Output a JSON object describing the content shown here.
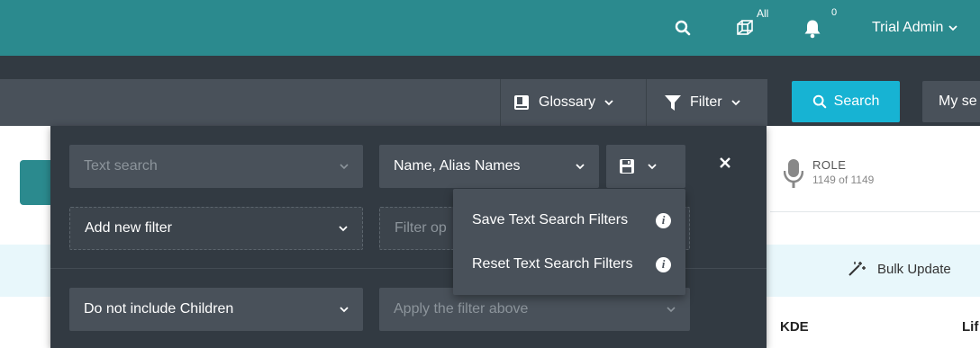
{
  "topbar": {
    "bg_color": "#2b8a8e",
    "tenant_badge": "All",
    "notification_count": "0",
    "user_name": "Trial Admin"
  },
  "searchbar": {
    "glossary_label": "Glossary",
    "filter_label": "Filter",
    "search_label": "Search",
    "my_search_label": "My se",
    "search_button_color": "#17b3d3"
  },
  "background": {
    "role_title": "ROLE",
    "role_count": "1149 of 1149",
    "bulk_update_label": "Bulk Update",
    "col_kde": "KDE",
    "col_lif": "Lif"
  },
  "filter_panel": {
    "text_search_placeholder": "Text search",
    "fields_selected": "Name, Alias Names",
    "add_filter_label": "Add new filter",
    "filter_op_placeholder": "Filter op",
    "children_option": "Do not include Children",
    "apply_filter_placeholder": "Apply the filter above"
  },
  "save_menu": {
    "items": [
      {
        "label": "Save Text Search Filters"
      },
      {
        "label": "Reset Text Search Filters"
      }
    ]
  }
}
